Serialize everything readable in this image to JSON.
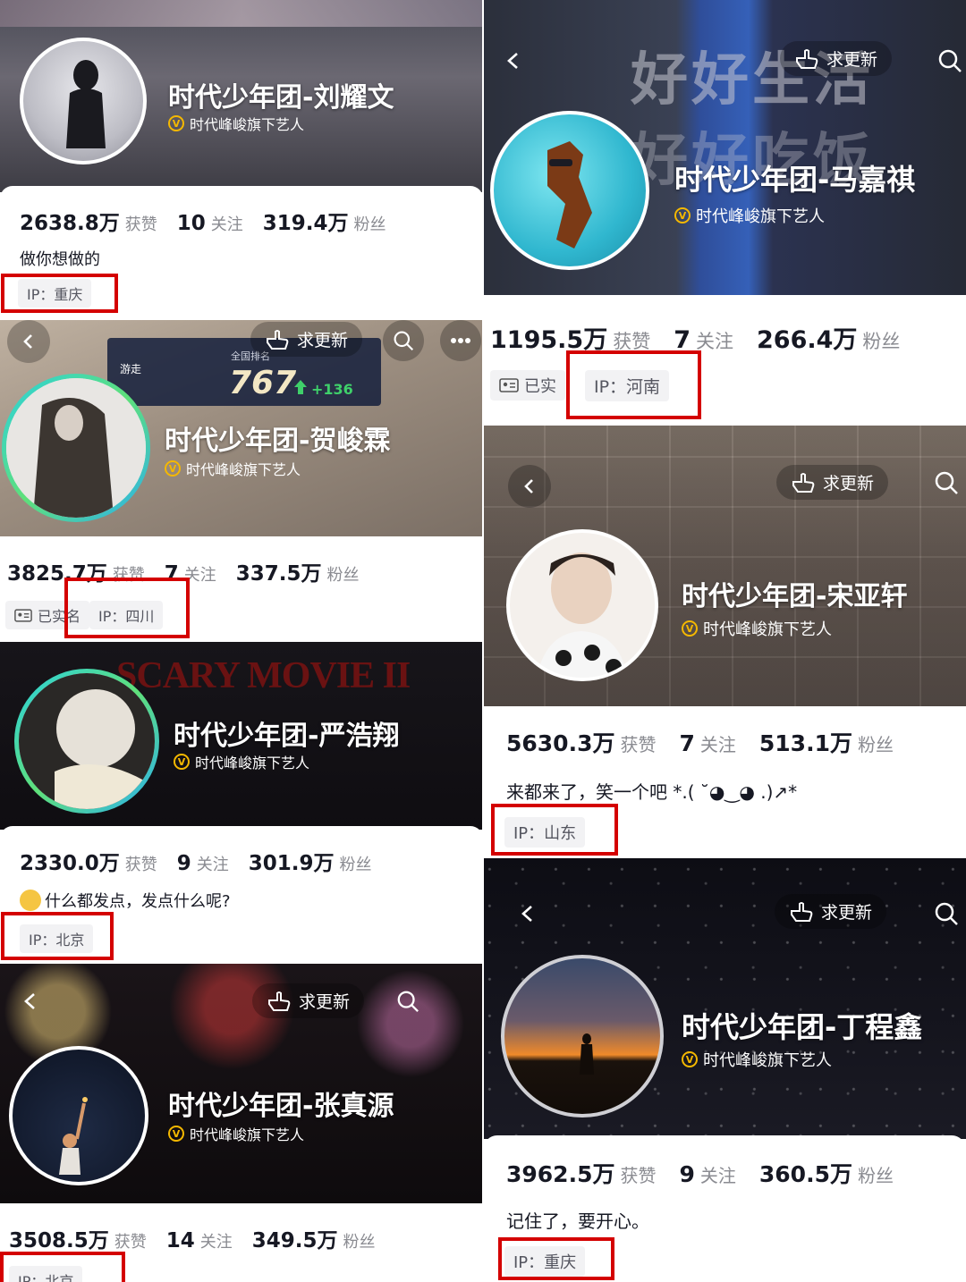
{
  "common": {
    "verify_text": "时代峰峻旗下艺人",
    "v_glyph": "V",
    "likes_label": "获赞",
    "following_label": "关注",
    "fans_label": "粉丝",
    "update_label": "求更新",
    "realname_label": "已实名",
    "realname_short": "已实",
    "icons": [
      "back-icon",
      "search-icon",
      "more-icon",
      "hand-point-icon",
      "id-card-icon",
      "verified-icon"
    ],
    "colors": {
      "highlight": "#d40000",
      "verify": "#f5b800",
      "rank_up": "#3fd06a"
    }
  },
  "profiles": [
    {
      "id": "liu",
      "name": "时代少年团-刘耀文",
      "likes": "2638.8万",
      "following": "10",
      "fans": "319.4万",
      "bio": "做你想做的",
      "ip": "IP：重庆"
    },
    {
      "id": "ma",
      "name": "时代少年团-马嘉祺",
      "banner_text": [
        "好好生活",
        "好好吃饭"
      ],
      "likes": "1195.5万",
      "following": "7",
      "fans": "266.4万",
      "ip": "IP：河南"
    },
    {
      "id": "he",
      "name": "时代少年团-贺峻霖",
      "rank": {
        "label": "全国排名",
        "side": "游走",
        "value": "767",
        "change": "+136"
      },
      "likes": "3825.7万",
      "following": "7",
      "fans": "337.5万",
      "ip": "IP：四川"
    },
    {
      "id": "song",
      "name": "时代少年团-宋亚轩",
      "likes": "5630.3万",
      "following": "7",
      "fans": "513.1万",
      "bio": "来都来了，笑一个吧 *.( ˘◕‿◕ .)↗*",
      "ip": "IP：山东"
    },
    {
      "id": "yan",
      "name": "时代少年团-严浩翔",
      "banner_text": "SCARY MOVIE II",
      "likes": "2330.0万",
      "following": "9",
      "fans": "301.9万",
      "bio": "什么都发点，发点什么呢?",
      "ip": "IP：北京"
    },
    {
      "id": "ding",
      "name": "时代少年团-丁程鑫",
      "likes": "3962.5万",
      "following": "9",
      "fans": "360.5万",
      "bio": "记住了，要开心。",
      "ip": "IP：重庆"
    },
    {
      "id": "zhang",
      "name": "时代少年团-张真源",
      "likes": "3508.5万",
      "following": "14",
      "fans": "349.5万",
      "ip": "IP：北京"
    }
  ]
}
